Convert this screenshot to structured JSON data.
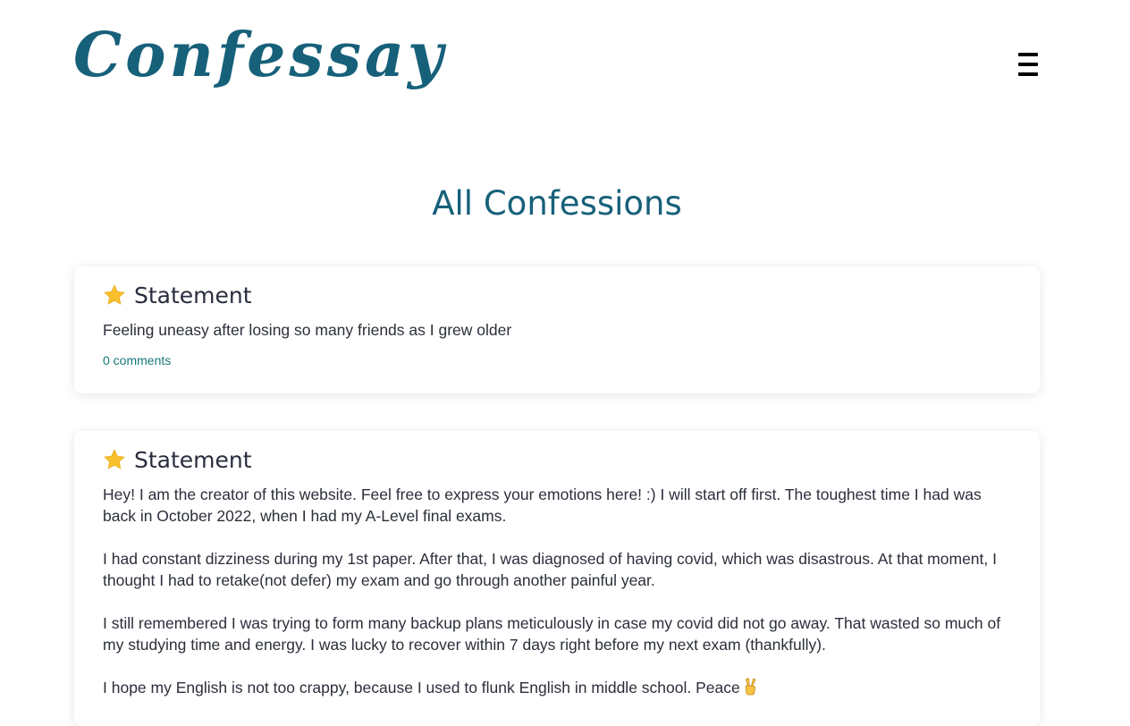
{
  "brand": {
    "logo_text": "Confessay",
    "accent_color": "#17607a"
  },
  "header": {
    "menu_icon": "hamburger-icon"
  },
  "page": {
    "title": "All Confessions"
  },
  "confessions": [
    {
      "icon": "star-icon",
      "title": "Statement",
      "body": "Feeling uneasy after losing so many friends as I grew older",
      "comments": "0 comments"
    },
    {
      "icon": "star-icon",
      "title": "Statement",
      "paragraphs": [
        "Hey! I am the creator of this website. Feel free to express your emotions here! :) I will start off first. The toughest time I had was back in October 2022, when I had my A-Level final exams.",
        "I had constant dizziness during my 1st paper. After that, I was diagnosed of having covid, which was disastrous. At that moment, I thought I had to retake(not defer) my exam and go through another painful year.",
        "I still remembered I was trying to form many backup plans meticulously in case my covid did not go away. That wasted so much of my studying time and energy. I was lucky to recover within 7 days right before my next exam (thankfully).",
        "I hope my English is not too crappy, because I used to flunk English in middle school. Peace"
      ],
      "trailing_icon": "victory-hand-icon"
    }
  ]
}
